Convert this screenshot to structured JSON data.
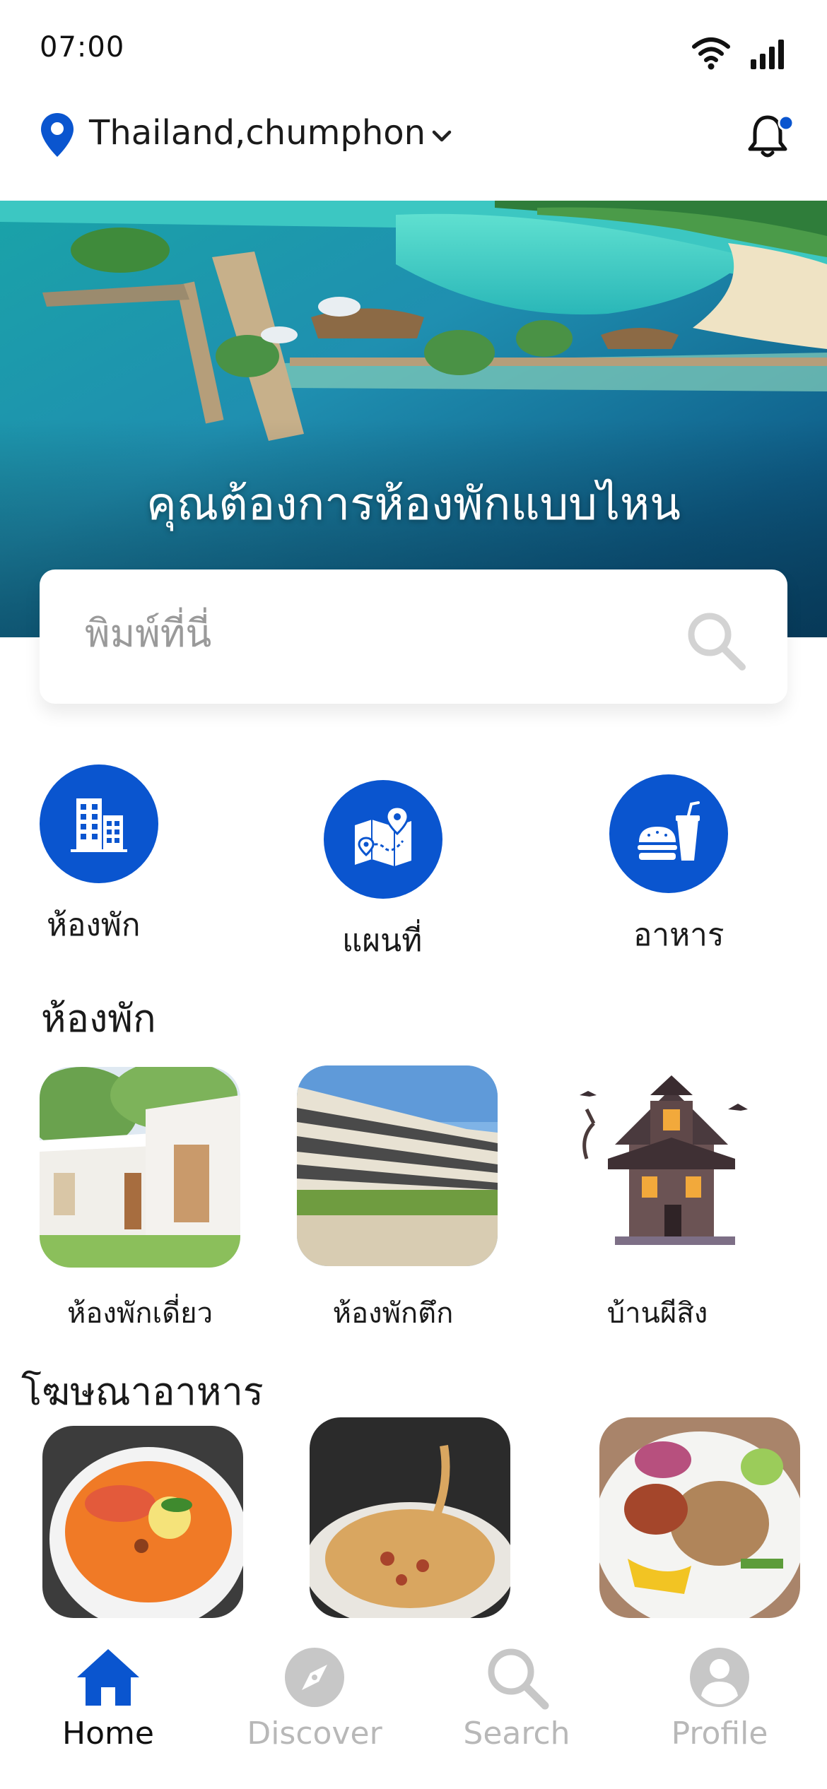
{
  "status": {
    "time": "07:00"
  },
  "header": {
    "location": "Thailand,chumphon"
  },
  "hero": {
    "title": "คุณต้องการห้องพักแบบไหน"
  },
  "search": {
    "placeholder": "พิมพ์ที่นี่"
  },
  "categories": [
    {
      "label": "ห้องพัก",
      "icon": "building-icon"
    },
    {
      "label": "แผนที่",
      "icon": "map-icon"
    },
    {
      "label": "อาหาร",
      "icon": "fast-food-icon"
    }
  ],
  "rooms": {
    "title": "ห้องพัก",
    "items": [
      {
        "label": "ห้องพักเดี่ยว"
      },
      {
        "label": "ห้องพักตึก"
      },
      {
        "label": "บ้านผีสิง"
      }
    ]
  },
  "food": {
    "title": "โฆษณาอาหาร"
  },
  "nav": {
    "items": [
      {
        "label": "Home",
        "icon": "home-icon",
        "active": true
      },
      {
        "label": "Discover",
        "icon": "compass-icon",
        "active": false
      },
      {
        "label": "Search",
        "icon": "search-icon",
        "active": false
      },
      {
        "label": "Profile",
        "icon": "profile-icon",
        "active": false
      }
    ]
  },
  "colors": {
    "accent": "#0a55cf",
    "inactive": "#b8b8b8",
    "text": "#1a1a1a"
  }
}
